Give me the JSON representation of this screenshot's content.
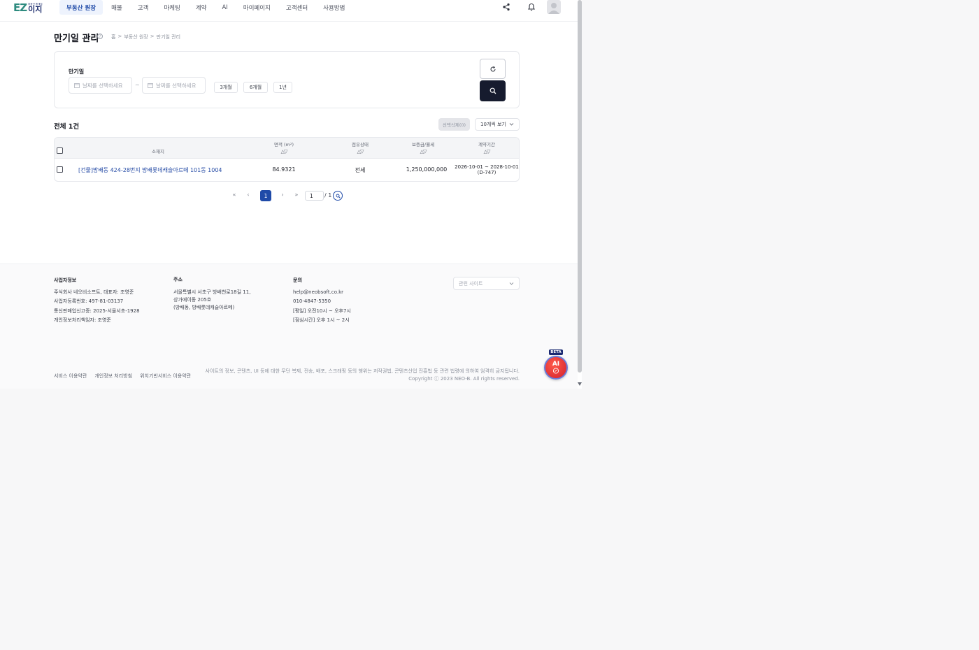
{
  "header": {
    "logo_ez": "EZ",
    "logo_small": "부동산 중개업",
    "logo_kr": "이지",
    "nav": [
      "부동산 원장",
      "매물",
      "고객",
      "마케팅",
      "계약",
      "AI",
      "마이페이지",
      "고객센터",
      "사용방법"
    ],
    "active_nav": "부동산 원장"
  },
  "page": {
    "title": "만기일 관리",
    "breadcrumb": [
      "홈",
      "부동산 원장",
      "만기일 관리"
    ]
  },
  "filter": {
    "label": "만기일",
    "start_placeholder": "날짜를 선택하세요",
    "separator": "~",
    "end_placeholder": "날짜를 선택하세요",
    "chips": [
      "3개월",
      "6개월",
      "1년"
    ]
  },
  "list": {
    "total": "전체 1건",
    "bulk_delete": "선택삭제(0)",
    "per_page": "10개씩 보기"
  },
  "table": {
    "columns": {
      "address": "소재지",
      "area": "면적 (m²)",
      "occupancy": "점유상태",
      "price": "보증금/월세",
      "period": "계약기간"
    },
    "sort_glyph": "△▽",
    "rows": [
      {
        "address": "[건물]방배동 424-28번지 방배롯데캐슬아르떼 101동 1004",
        "area": "84.9321",
        "occupancy": "전세",
        "price": "1,250,000,000",
        "period_range": "2026-10-01 ~ 2028-10-01",
        "period_dday": "(D-747)"
      }
    ]
  },
  "pagination": {
    "first": "«",
    "prev": "‹",
    "current": "1",
    "next": "›",
    "last": "»",
    "page_input": "1",
    "total_pages": "/ 1"
  },
  "footer": {
    "biz": {
      "heading": "사업자정보",
      "lines": [
        "주식회사 네오비소프트, 대표자: 조영준",
        "사업자등록번호: 497-81-03137",
        "통신판매업신고증: 2025-서울서초-1928",
        "개인정보처리책임자: 조영준"
      ]
    },
    "addr": {
      "heading": "주소",
      "lines": [
        "서울특별시 서초구 방배천로18길 11,",
        "상가에이동 205호",
        "(방배동, 방배롯데캐슬아르떼)"
      ]
    },
    "contact": {
      "heading": "문의",
      "lines": [
        "help@neobsoft.co.kr",
        "010-4847-5350",
        "[평일] 오전10시 ~ 오후7시",
        "[점심시간] 오후 1시 ~ 2시"
      ]
    },
    "related_sites": "관련 사이트",
    "links": [
      "서비스 이용약관",
      "개인정보 처리방침",
      "위치기반서비스 이용약관"
    ],
    "notice": "사이트의 정보, 콘텐츠, UI 등에 대한 무단 복제, 전송, 배포, 스크래핑 등의 행위는 저작권법, 콘텐츠산업 진흥법 등 관련 법령에 의하여 엄격히 금지됩니다.",
    "copyright": "Copyright ⓒ 2023 NEO-B. All rights reserved."
  },
  "ai_button": {
    "badge": "BETA",
    "label": "AI"
  },
  "colors": {
    "primary": "#1f4aa8",
    "dark_button": "#161b2e",
    "ai_red": "#d21f2c",
    "link": "#244aa5"
  },
  "icons": [
    "share-icon",
    "bell-icon",
    "avatar-icon",
    "help-icon",
    "calendar-icon",
    "refresh-icon",
    "search-icon",
    "chevron-down-icon",
    "chat-icon"
  ]
}
